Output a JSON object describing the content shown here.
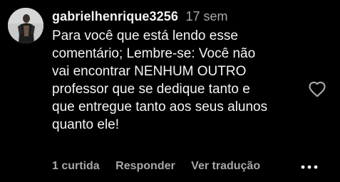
{
  "comment": {
    "username": "gabrielhenrique3256",
    "timestamp": "17 sem",
    "text_lines": [
      "Para você que está lendo esse",
      "comentário; Lembre-se: Você não",
      "vai encontrar NENHUM OUTRO",
      "professor que se dedique tanto e",
      "que entregue tanto aos seus alunos",
      "quanto ele!"
    ],
    "like_icon": "heart-outline-icon",
    "more_icon": "ellipsis-icon"
  },
  "actions": {
    "likes_label": "1 curtida",
    "reply_label": "Responder",
    "translate_label": "Ver tradução"
  },
  "colors": {
    "background": "#000000",
    "primary_text": "#f5f5f5",
    "secondary_text": "#a8a8a8"
  }
}
